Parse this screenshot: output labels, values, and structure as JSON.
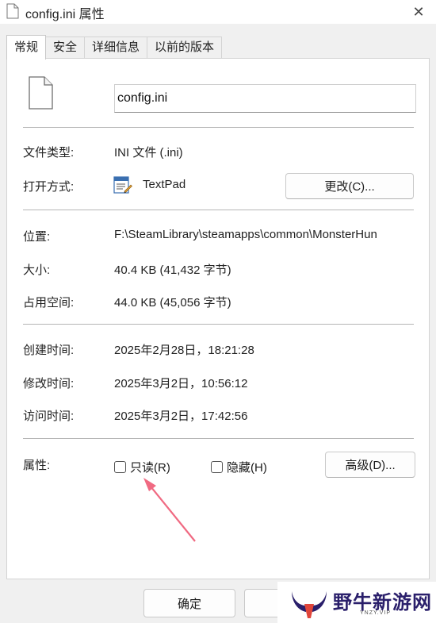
{
  "window": {
    "title": "config.ini 属性",
    "close_glyph": "✕"
  },
  "tabs": [
    {
      "label": "常规",
      "active": true
    },
    {
      "label": "安全",
      "active": false
    },
    {
      "label": "详细信息",
      "active": false
    },
    {
      "label": "以前的版本",
      "active": false
    }
  ],
  "general": {
    "file_name": "config.ini",
    "type_label": "文件类型:",
    "type_value": "INI 文件 (.ini)",
    "open_with_label": "打开方式:",
    "open_with_value": "TextPad",
    "change_button": "更改(C)...",
    "location_label": "位置:",
    "location_value": "F:\\SteamLibrary\\steamapps\\common\\MonsterHun",
    "size_label": "大小:",
    "size_value": "40.4 KB (41,432 字节)",
    "size_on_disk_label": "占用空间:",
    "size_on_disk_value": "44.0 KB (45,056 字节)",
    "created_label": "创建时间:",
    "created_value": "2025年2月28日，18:21:28",
    "modified_label": "修改时间:",
    "modified_value": "2025年3月2日，10:56:12",
    "accessed_label": "访问时间:",
    "accessed_value": "2025年3月2日，17:42:56",
    "attributes_label": "属性:",
    "readonly_label": "只读(R)",
    "readonly_checked": false,
    "hidden_label": "隐藏(H)",
    "hidden_checked": false,
    "advanced_button": "高级(D)..."
  },
  "footer": {
    "ok_button": "确定"
  },
  "watermark": {
    "text": "野牛新游网",
    "sub": "YNZY.VIP"
  },
  "colors": {
    "annotation_arrow": "#f06a82",
    "watermark_text": "#2a1f6b"
  },
  "icons": {
    "file": "file-icon",
    "app": "textpad-icon",
    "close": "close-icon",
    "watermark_logo": "bull-horns-logo"
  }
}
